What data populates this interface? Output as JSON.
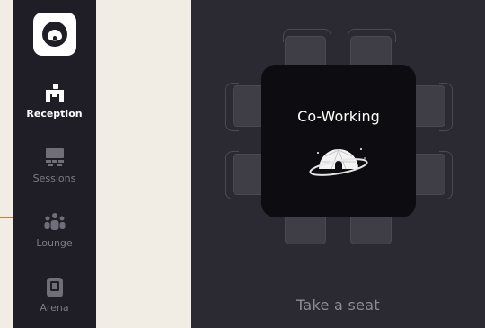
{
  "sidebar": {
    "logo": "app-logo",
    "items": [
      {
        "label": "Reception",
        "icon": "reception-desk-icon",
        "active": true
      },
      {
        "label": "Sessions",
        "icon": "stage-icon",
        "active": false
      },
      {
        "label": "Lounge",
        "icon": "people-group-icon",
        "active": false
      },
      {
        "label": "Arena",
        "icon": "arena-screen-icon",
        "active": false
      }
    ]
  },
  "main": {
    "table_title": "Co-Working",
    "table_icon": "dome-planet-icon",
    "cta": "Take a seat"
  },
  "colors": {
    "sidebar_bg": "#1f1e27",
    "main_bg": "#2b2a32",
    "table_bg": "#0d0d11",
    "seat": "#3f3e47",
    "accent": "#d9772e",
    "page_bg": "#f1ede4"
  }
}
